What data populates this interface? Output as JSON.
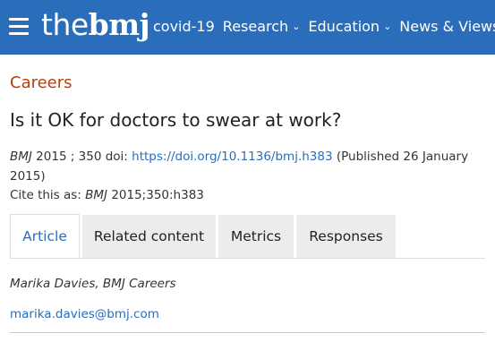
{
  "header": {
    "logo_the": "the",
    "logo_bmj": "bmj",
    "nav": [
      {
        "label": "covid-19",
        "has_dropdown": false
      },
      {
        "label": "Research",
        "has_dropdown": true
      },
      {
        "label": "Education",
        "has_dropdown": true
      },
      {
        "label": "News & Views",
        "has_dropdown": true
      }
    ],
    "chevron": "⌄"
  },
  "article": {
    "section": "Careers",
    "title": "Is it OK for doctors to swear at work?",
    "journal": "BMJ",
    "year_vol": " 2015 ; 350",
    "doi_prefix": " doi: ",
    "doi_link": "https://doi.org/10.1136/bmj.h383",
    "published": " (Published 26 January 2015)",
    "cite_prefix": "Cite this as: ",
    "cite_journal": "BMJ",
    "cite_ref": " 2015;350:h383",
    "author": "Marika Davies, BMJ Careers",
    "email": "marika.davies@bmj.com"
  },
  "tabs": [
    {
      "label": "Article",
      "active": true
    },
    {
      "label": "Related content",
      "active": false
    },
    {
      "label": "Metrics",
      "active": false
    },
    {
      "label": "Responses",
      "active": false
    }
  ],
  "colors": {
    "brand_blue": "#2a6ebb",
    "section_orange": "#b5400b"
  }
}
